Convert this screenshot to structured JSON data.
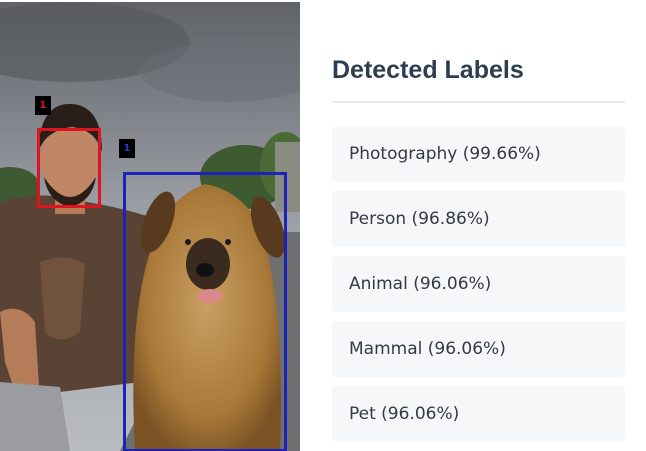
{
  "image": {
    "detections": [
      {
        "tag": "1",
        "class": "person-face",
        "color": "#e0141e"
      },
      {
        "tag": "1",
        "class": "dog",
        "color": "#1d22b8"
      }
    ]
  },
  "panel": {
    "title": "Detected Labels",
    "labels": [
      {
        "text": "Photography (99.66%)"
      },
      {
        "text": "Person (96.86%)"
      },
      {
        "text": "Animal (96.06%)"
      },
      {
        "text": "Mammal (96.06%)"
      },
      {
        "text": "Pet (96.06%)"
      }
    ]
  }
}
